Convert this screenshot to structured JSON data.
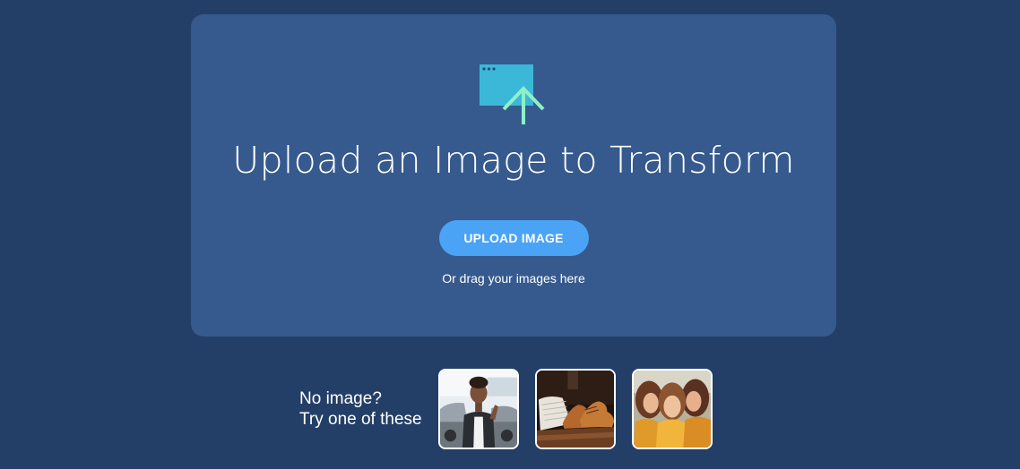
{
  "dropzone": {
    "icon": "upload-window-icon",
    "title": "Upload an Image to Transform",
    "upload_button_label": "UPLOAD IMAGE",
    "drag_hint": "Or drag your images here"
  },
  "samples": {
    "label_line1": "No image?",
    "label_line2": "Try one of these",
    "items": [
      {
        "icon": "person-with-car-image"
      },
      {
        "icon": "shoes-and-sweater-image"
      },
      {
        "icon": "three-women-selfie-image"
      }
    ]
  },
  "colors": {
    "background": "#243f67",
    "panel": "#365a8e",
    "button": "#4aa3f5",
    "icon_window": "#3bb8d8",
    "icon_arrow": "#8ff0c8"
  }
}
